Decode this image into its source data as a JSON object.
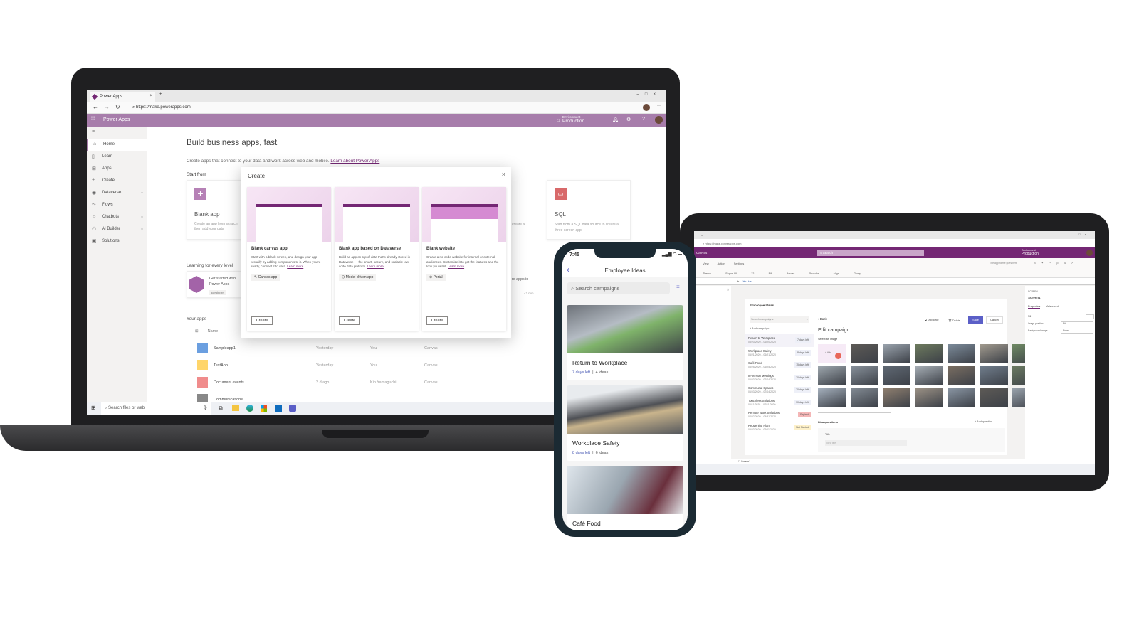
{
  "laptop": {
    "browser": {
      "tab_title": "Power Apps",
      "url": "https://make.powerapps.com"
    },
    "header": {
      "app_name": "Power Apps",
      "env_label": "Environment",
      "env_value": "Production"
    },
    "sidebar": [
      {
        "label": "Home",
        "icon": "home-icon"
      },
      {
        "label": "Learn",
        "icon": "book-icon"
      },
      {
        "label": "Apps",
        "icon": "apps-icon"
      },
      {
        "label": "Create",
        "icon": "plus-icon"
      },
      {
        "label": "Dataverse",
        "icon": "database-icon",
        "chevron": true
      },
      {
        "label": "Flows",
        "icon": "flow-icon"
      },
      {
        "label": "Chatbots",
        "icon": "bot-icon",
        "chevron": true
      },
      {
        "label": "AI Builder",
        "icon": "ai-icon",
        "chevron": true
      },
      {
        "label": "Solutions",
        "icon": "solutions-icon"
      }
    ],
    "main": {
      "title": "Build business apps, fast",
      "subtitle": "Create apps that connect to your data and work across web and mobile.",
      "subtitle_link": "Learn about Power Apps",
      "start_from": "Start from",
      "blank_app": {
        "title": "Blank app",
        "desc": "Create an app from scratch, then add your data"
      },
      "sql": {
        "title": "SQL",
        "desc": "Start from a SQL data source to create a three-screen app"
      },
      "partial_card_text": "create a",
      "learning": "Learning for every level",
      "learn_card": {
        "title": "Get started with Power Apps",
        "level": "Beginner",
        "right_text": "re apps in",
        "duration": "42 min"
      },
      "your_apps": "Your apps",
      "col_name": "Name",
      "apps": [
        {
          "name": "Sampleapp1",
          "modified": "Yesterday",
          "owner": "You",
          "type": "Canvas",
          "color": "#6b9fe0"
        },
        {
          "name": "TestApp",
          "modified": "Yesterday",
          "owner": "You",
          "type": "Canvas",
          "color": "#ffd56a"
        },
        {
          "name": "Document events",
          "modified": "2 d ago",
          "owner": "Kin Yamaguchi",
          "type": "Canvas",
          "color": "#f08c8c"
        },
        {
          "name": "Communications",
          "modified": "",
          "owner": "",
          "type": "",
          "color": "#888888"
        }
      ]
    },
    "dialog": {
      "title": "Create",
      "cards": [
        {
          "title": "Blank canvas app",
          "desc": "Start with a blank screen, and design your app visually by adding components to it. When you're ready, connect it to data.",
          "link": "Learn more",
          "tag": "✎ Canvas app",
          "button": "Create"
        },
        {
          "title": "Blank app based on Dataverse",
          "desc": "Build an app on top of data that's already stored in Dataverse — the smart, secure, and scalable low-code data platform.",
          "link": "Learn more",
          "tag": "⬡ Model-driven app",
          "button": "Create"
        },
        {
          "title": "Blank website",
          "desc": "Create a no-code website for internal or external audiences. Customize it to get the features and the look you want.",
          "link": "Learn more",
          "tag": "⊕ Portal",
          "button": "Create"
        }
      ]
    },
    "taskbar": {
      "search": "Search files or web"
    }
  },
  "phone": {
    "time": "7:45",
    "title": "Employee Ideas",
    "search_placeholder": "Search campaigns",
    "cards": [
      {
        "title": "Return to Workplace",
        "days": "7 days left",
        "ideas": "4 ideas"
      },
      {
        "title": "Workplace Safety",
        "days": "8 days left",
        "ideas": "6 ideas"
      },
      {
        "title": "Café Food",
        "days": "",
        "ideas": ""
      }
    ]
  },
  "tablet": {
    "url": "https://make.powerapps.com",
    "app_label": "Canvas",
    "search": "Search",
    "env_label": "Environment",
    "env_value": "Production",
    "menu": [
      "View",
      "Action",
      "Settings"
    ],
    "app_name_hint": "The app name goes here",
    "toolbar": [
      "Theme",
      "Segoe UI",
      "12",
      "Fill",
      "Border",
      "Reorder",
      "Align",
      "Group"
    ],
    "formula": "White",
    "app_title": "Employee Ideas",
    "list_search": "Search campaigns",
    "add_campaign": "Add campaign",
    "campaigns": [
      {
        "name": "Return to Workplace",
        "dates": "05/20/2020 – 06/20/2020",
        "status": "7 days left"
      },
      {
        "name": "Workplace Safety",
        "dates": "05/21/2020 – 06/21/2020",
        "status": "8 days left"
      },
      {
        "name": "Café Food",
        "dates": "05/25/2020 – 06/25/2020",
        "status": "15 days left"
      },
      {
        "name": "In-person Meetings",
        "dates": "06/03/2020 – 07/04/2020",
        "status": "20 days left"
      },
      {
        "name": "Communal Spaces",
        "dates": "06/03/2020 – 07/04/2020",
        "status": "20 days left"
      },
      {
        "name": "Touchless Solutions",
        "dates": "06/11/2020 – 07/11/2020",
        "status": "30 days left"
      },
      {
        "name": "Remote Work Solutions",
        "dates": "04/02/2020 – 04/31/2020",
        "status": "Expired"
      },
      {
        "name": "Reopening Plan",
        "dates": "05/03/2020 – 06/11/2020",
        "status": "Not Started"
      }
    ],
    "back": "Back",
    "duplicate": "Duplicate",
    "delete": "Delete",
    "save": "Save",
    "cancel": "Cancel",
    "edit_title": "Edit campaign",
    "select_image": "Select an image",
    "add_image": "+ Add",
    "idea_questions": "Idea questions",
    "add_question": "+ Add question",
    "field_title": "Title",
    "field_placeholder": "Idea title",
    "props": {
      "section": "SCREEN",
      "name": "Screen1",
      "tab_properties": "Properties",
      "tab_advanced": "Advanced",
      "fill": "Fill",
      "image_position": "Image position",
      "image_position_value": "Fit",
      "background_image": "Background image",
      "background_image_value": "None"
    },
    "status_screen": "Screen1"
  },
  "colors": {
    "powerapps_purple": "#742774",
    "header_light": "#a77dab",
    "expired": "#f4b6b6",
    "not_started": "#fdf0c8",
    "save": "#5b5fc7"
  }
}
